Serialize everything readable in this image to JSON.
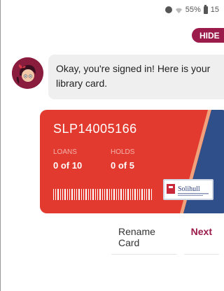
{
  "status_bar": {
    "battery": "55%",
    "time": "15",
    "icons": [
      "alarm-icon",
      "wifi-icon",
      "battery-icon"
    ]
  },
  "hide_button": {
    "label": "HIDE"
  },
  "message": {
    "text": "Okay, you're signed in! Here is your library card."
  },
  "card": {
    "number": "SLP14005166",
    "loans_label": "LOANS",
    "loans_value": "0 of 10",
    "holds_label": "HOLDS",
    "holds_value": "0 of 5",
    "logo_name": "Solihull",
    "colors": {
      "primary": "#e23a2e",
      "stripe": "#2f4f8a"
    }
  },
  "actions": {
    "rename": "Rename Card",
    "next": "Next"
  },
  "colors": {
    "accent": "#9b1b4b",
    "bubble": "#efefef"
  }
}
